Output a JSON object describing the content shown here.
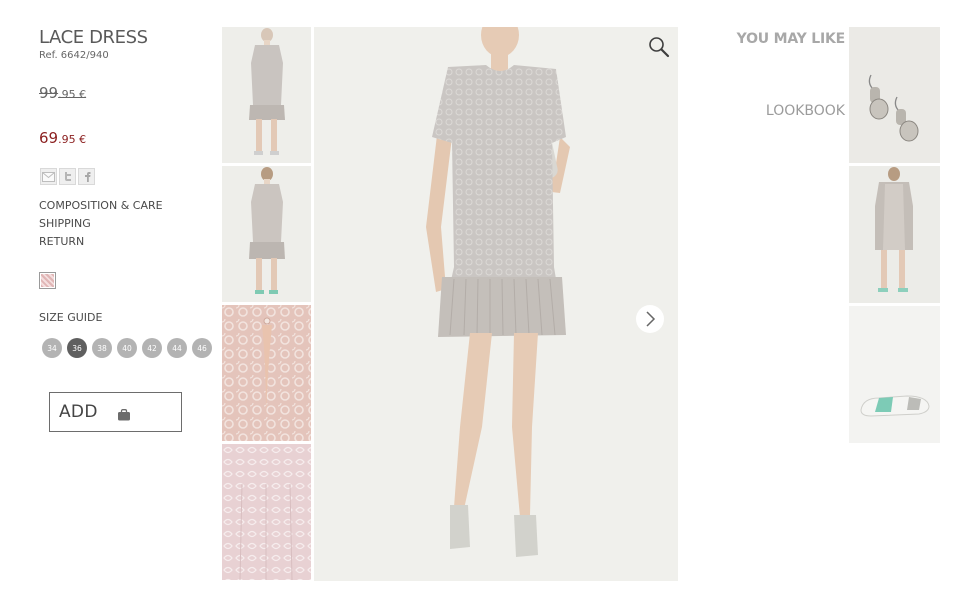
{
  "product": {
    "title": "LACE DRESS",
    "ref": "Ref. 6642/940",
    "old_price_int": "99",
    "old_price_dec": ".95 €",
    "new_price_int": "69",
    "new_price_dec": ".95 €"
  },
  "share_icons": [
    "email-icon",
    "twitter-icon",
    "facebook-icon"
  ],
  "info_links": [
    "COMPOSITION & CARE",
    "SHIPPING",
    "RETURN"
  ],
  "size_guide_label": "SIZE GUIDE",
  "sizes": [
    "34",
    "36",
    "38",
    "40",
    "42",
    "44",
    "46"
  ],
  "selected_size": "36",
  "add_button": {
    "label": "ADD",
    "icon": "shopping-bag-icon"
  },
  "main_image": {
    "zoom_icon": "magnifier-icon",
    "next_icon": "chevron-right-icon"
  },
  "sidebar": {
    "you_may_like": "YOU MAY LIKE",
    "lookbook": "LOOKBOOK"
  },
  "colors": {
    "sale_price": "#8b1f1f",
    "selected_size": "#5f5f5f",
    "size": "#b3b3b3"
  }
}
